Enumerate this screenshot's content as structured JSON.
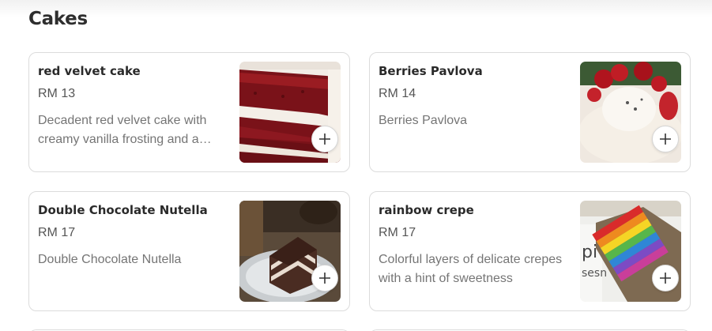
{
  "section": {
    "title": "Cakes"
  },
  "items": [
    {
      "name": "red velvet cake",
      "price": "RM 13",
      "description": "Decadent red velvet cake with creamy vanilla frosting and a touch of cocoa",
      "image": "red-velvet-cake-image",
      "add_label": "+"
    },
    {
      "name": "Berries Pavlova",
      "price": "RM 14",
      "description": "Berries Pavlova",
      "image": "berries-pavlova-image",
      "add_label": "+"
    },
    {
      "name": "Double Chocolate Nutella",
      "price": "RM 17",
      "description": "Double Chocolate Nutella",
      "image": "double-chocolate-nutella-image",
      "add_label": "+"
    },
    {
      "name": "rainbow crepe",
      "price": "RM 17",
      "description": "Colorful layers of delicate crepes with a hint of sweetness",
      "image": "rainbow-crepe-image",
      "add_label": "+"
    }
  ],
  "colors": {
    "border": "#dcdcdc",
    "text": "#2a2a2a",
    "muted": "#757575"
  }
}
